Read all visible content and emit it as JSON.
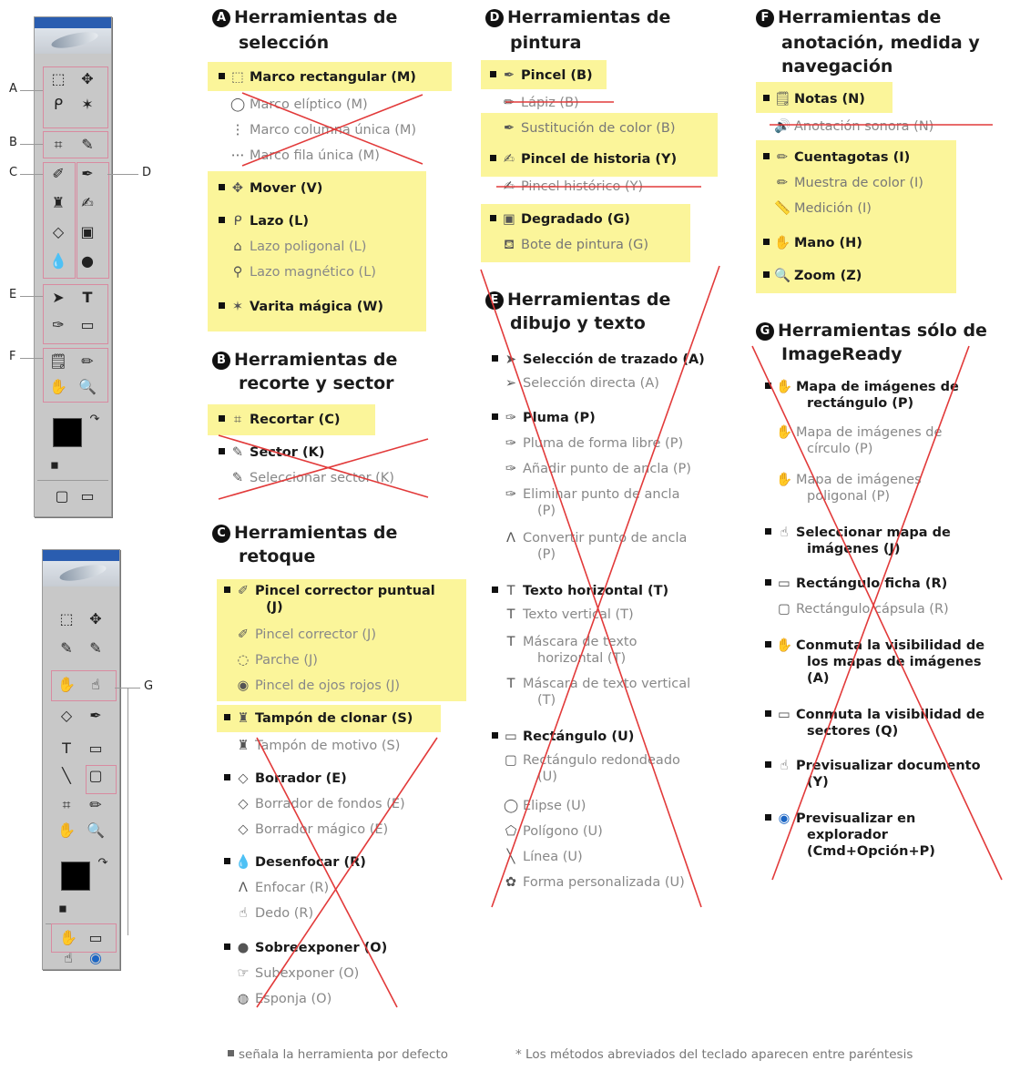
{
  "toolbox_labels": {
    "A": "A",
    "B": "B",
    "C": "C",
    "D": "D",
    "E": "E",
    "F": "F",
    "G": "G"
  },
  "sections": {
    "A": {
      "badge": "A",
      "title_l1": "Herramientas de",
      "title_l2": "selección",
      "items": [
        "Marco rectangular (M)",
        "Marco elíptico (M)",
        "Marco columna única (M)",
        "Marco fila única (M)",
        "Mover (V)",
        "Lazo (L)",
        "Lazo poligonal (L)",
        "Lazo magnético (L)",
        "Varita mágica (W)"
      ]
    },
    "B": {
      "badge": "B",
      "title_l1": "Herramientas de",
      "title_l2": "recorte y sector",
      "items": [
        "Recortar (C)",
        "Sector (K)",
        "Seleccionar sector (K)"
      ]
    },
    "C": {
      "badge": "C",
      "title_l1": "Herramientas de",
      "title_l2": "retoque",
      "items": [
        "Pincel corrector puntual",
        "(J)",
        "Pincel corrector (J)",
        "Parche (J)",
        "Pincel de ojos rojos (J)",
        "Tampón de clonar (S)",
        "Tampón de motivo (S)",
        "Borrador (E)",
        "Borrador de fondos (E)",
        "Borrador mágico (E)",
        "Desenfocar (R)",
        "Enfocar (R)",
        "Dedo (R)",
        "Sobreexponer (O)",
        "Subexponer (O)",
        "Esponja (O)"
      ]
    },
    "D": {
      "badge": "D",
      "title_l1": "Herramientas de",
      "title_l2": "pintura",
      "items": [
        "Pincel (B)",
        "Lápiz (B)",
        "Sustitución de color (B)",
        "Pincel de historia (Y)",
        "Pincel histórico (Y)",
        "Degradado (G)",
        "Bote de pintura (G)"
      ]
    },
    "E": {
      "badge": "E",
      "title_l1": "Herramientas de",
      "title_l2": "dibujo y texto",
      "items": [
        "Selección de trazado (A)",
        "Selección directa (A)",
        "Pluma (P)",
        "Pluma de forma libre (P)",
        "Añadir punto de ancla (P)",
        "Eliminar punto de ancla",
        "(P)",
        "Convertir punto de ancla",
        "(P)",
        "Texto horizontal (T)",
        "Texto vertical (T)",
        "Máscara de texto",
        "horizontal (T)",
        "Máscara de texto vertical",
        "(T)",
        "Rectángulo (U)",
        "Rectángulo redondeado",
        "(U)",
        "Elipse (U)",
        "Polígono (U)",
        "Línea (U)",
        "Forma personalizada (U)"
      ]
    },
    "F": {
      "badge": "F",
      "title_l1": "Herramientas de",
      "title_l2": "anotación, medida y",
      "title_l3": "navegación",
      "items": [
        "Notas (N)",
        "Anotación sonora (N)",
        "Cuentagotas (I)",
        "Muestra de color (I)",
        "Medición (I)",
        "Mano (H)",
        "Zoom (Z)"
      ]
    },
    "G": {
      "badge": "G",
      "title_l1": "Herramientas sólo de",
      "title_l2": "ImageReady",
      "items": [
        "Mapa de imágenes de",
        "rectángulo (P)",
        "Mapa de imágenes de",
        "círculo (P)",
        "Mapa de imágenes",
        "poligonal (P)",
        "Seleccionar mapa de",
        "imágenes (J)",
        "Rectángulo ficha (R)",
        "Rectángulo cápsula (R)",
        "Conmuta la visibilidad de",
        "los mapas de imágenes",
        "(A)",
        "Conmuta la visibilidad de",
        "sectores (Q)",
        "Previsualizar documento",
        "(Y)",
        "Previsualizar en",
        "explorador",
        "(Cmd+Opción+P)"
      ]
    }
  },
  "footer": {
    "legend": "señala la herramienta por defecto",
    "note": "* Los métodos abreviados del teclado aparecen entre paréntesis"
  },
  "colors": {
    "highlight": "#fbf59a",
    "strike": "#e23a3a",
    "badge": "#111111",
    "box": "#d98aa0"
  }
}
